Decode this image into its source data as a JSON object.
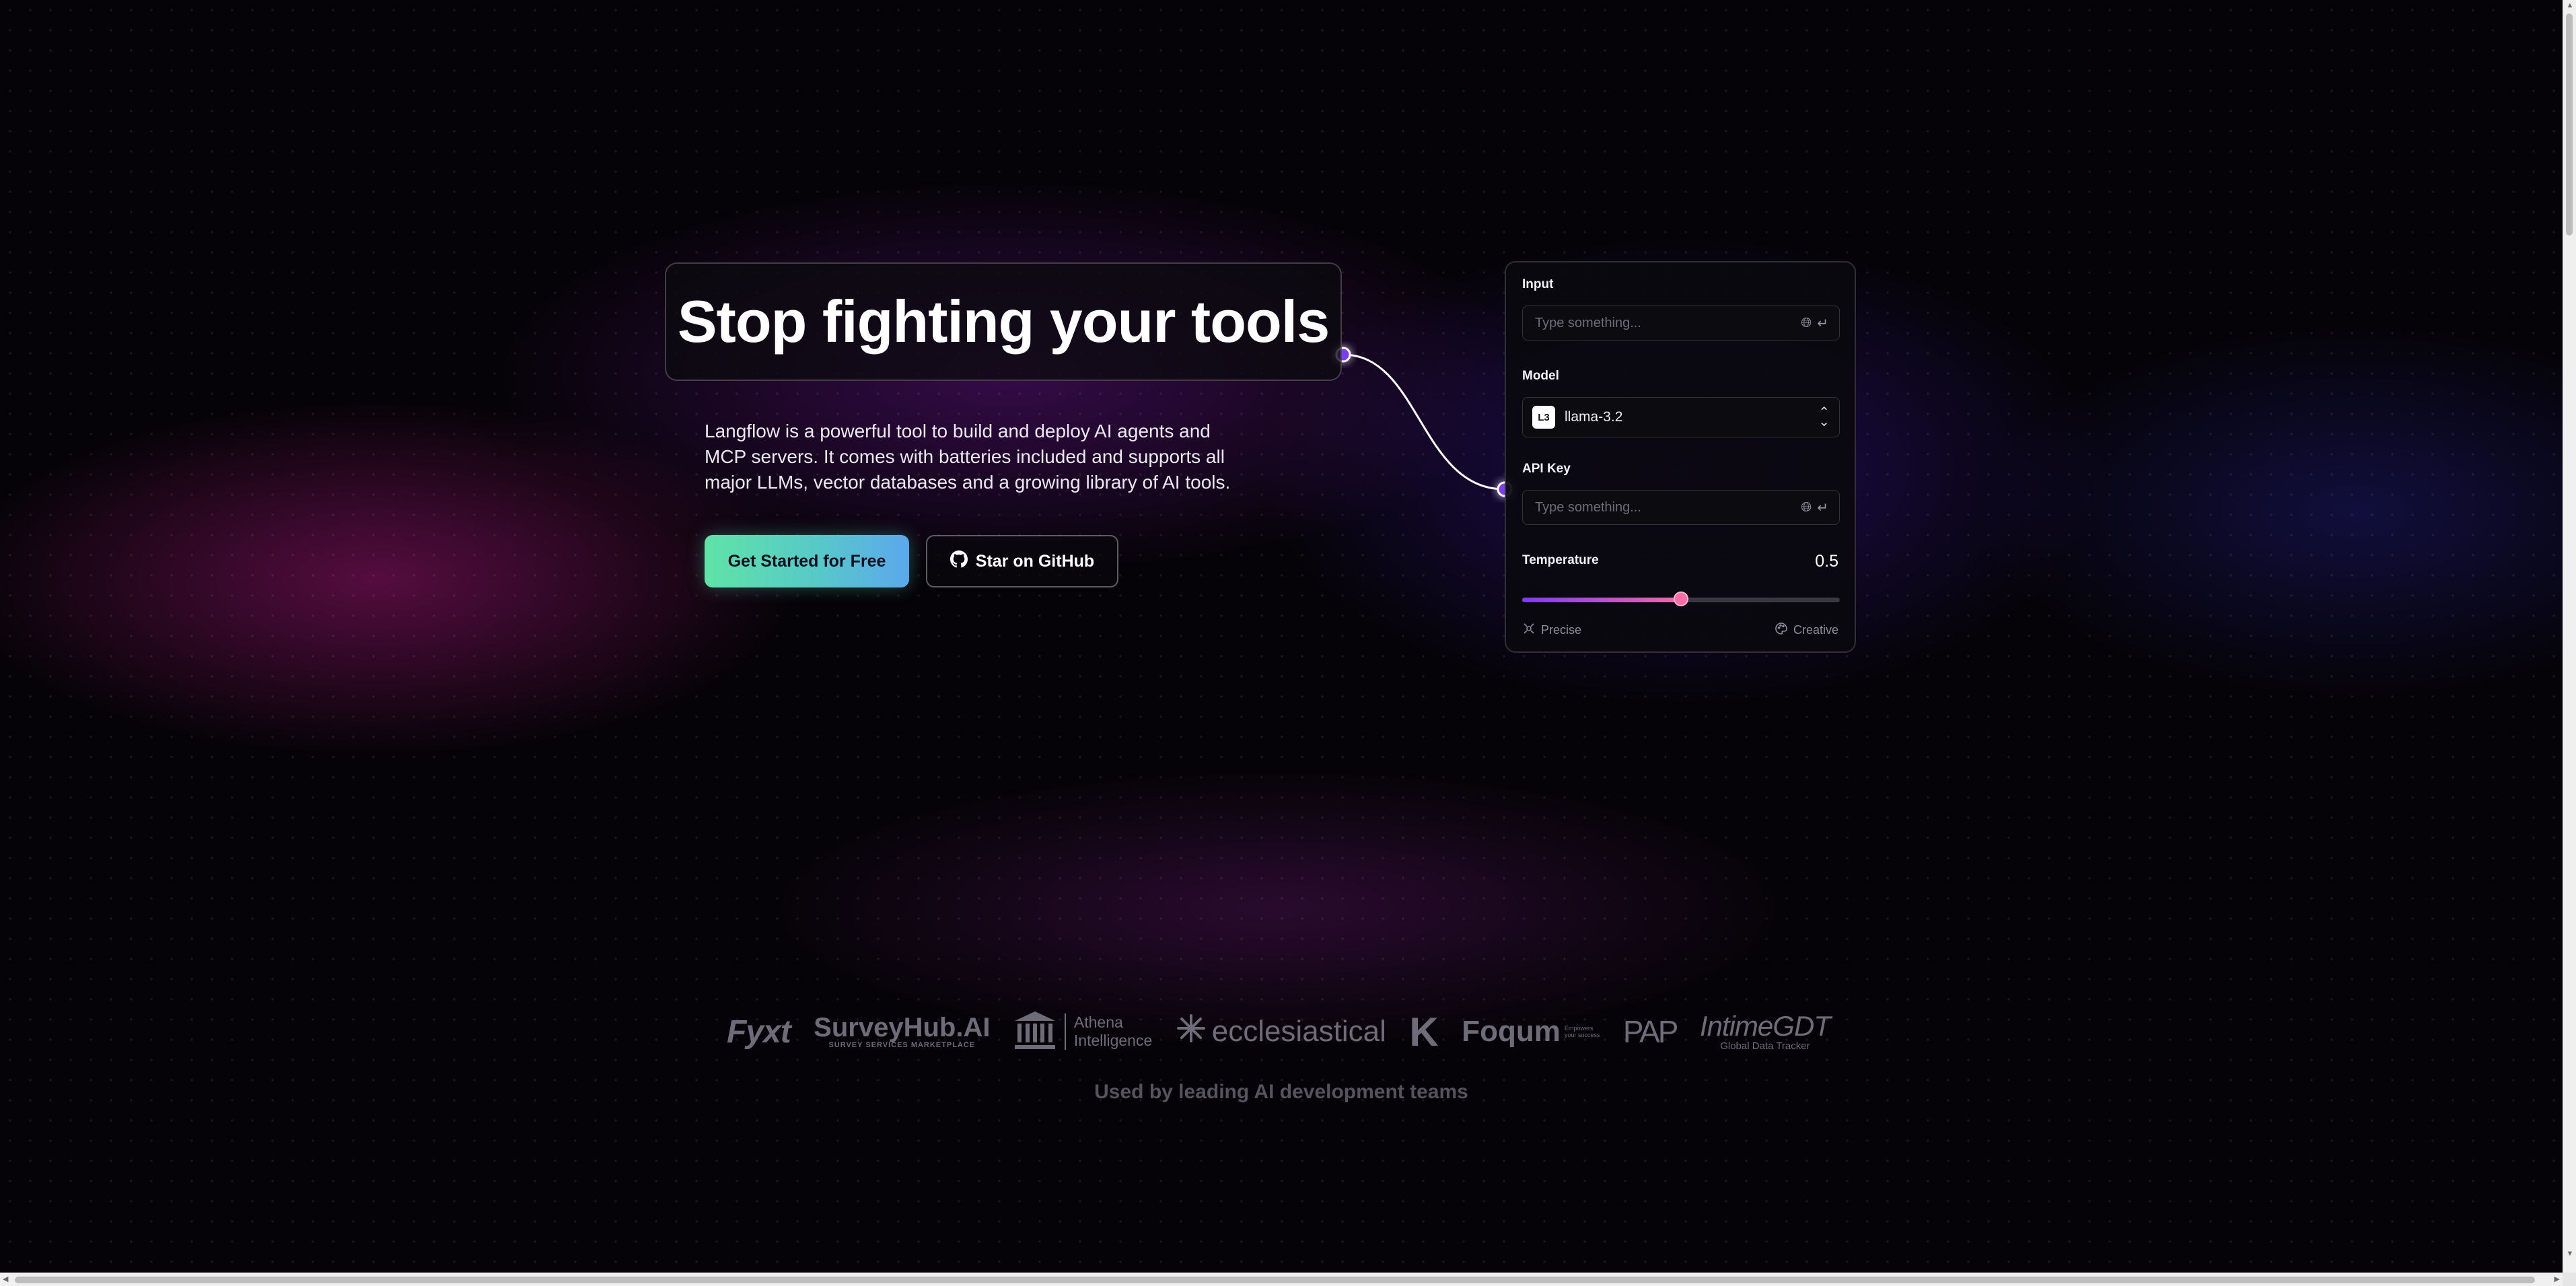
{
  "hero": {
    "title": "Stop fighting your tools",
    "description": "Langflow is a powerful tool to build and deploy AI agents and MCP servers. It comes with batteries included and supports all major LLMs, vector databases and a growing library of AI tools.",
    "primary_cta": "Get Started for Free",
    "secondary_cta": "Star on GitHub"
  },
  "panel": {
    "input_label": "Input",
    "input_placeholder": "Type something...",
    "model_label": "Model",
    "model_badge": "L3",
    "model_value": "llama-3.2",
    "api_key_label": "API Key",
    "api_key_placeholder": "Type something...",
    "temperature_label": "Temperature",
    "temperature_value": "0.5",
    "temperature_fraction": 0.5,
    "precise_label": "Precise",
    "creative_label": "Creative"
  },
  "logos": {
    "fyxt": "Fyxt",
    "surveyhub": "SurveyHub.AI",
    "surveyhub_tag": "SURVEY SERVICES MARKETPLACE",
    "athena_line1": "Athena",
    "athena_line2": "Intelligence",
    "ecclesiastical": "ecclesiastical",
    "k": "K",
    "foqum": "Foqum",
    "foqum_tag_1": "Empowers",
    "foqum_tag_2": "your success",
    "pap": "PAP",
    "intime": "IntimeGDT",
    "intime_tag": "Global Data Tracker"
  },
  "used_by": "Used by leading AI development teams",
  "colors": {
    "accent_purple": "#7d3cf0",
    "slider_pink": "#f56ea6",
    "cta_green": "#5fe3a6",
    "cta_blue": "#5ba8ec"
  }
}
